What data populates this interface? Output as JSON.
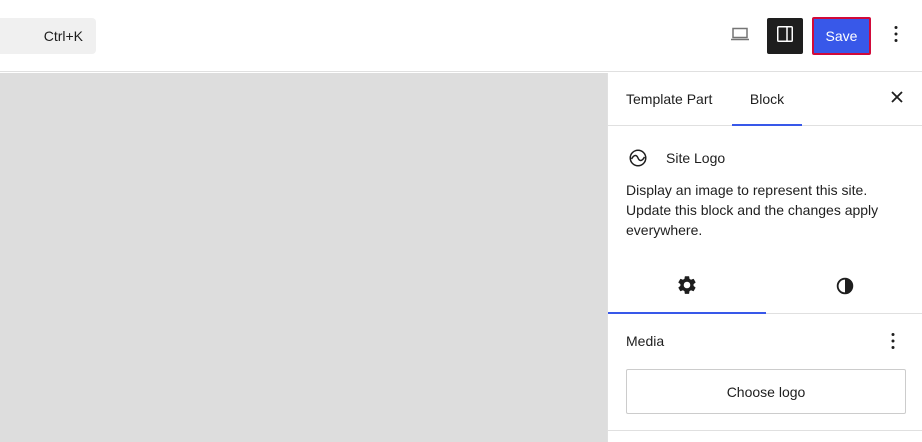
{
  "header": {
    "shortcut_hint": "Ctrl+K",
    "save_label": "Save",
    "device_icon": "laptop-icon",
    "settings_icon": "sidebar-toggle-icon",
    "more_icon": "vertical-ellipsis-icon"
  },
  "sidebar": {
    "tabs": [
      {
        "label": "Template Part",
        "active": false
      },
      {
        "label": "Block",
        "active": true
      }
    ],
    "close_icon": "close-icon",
    "block": {
      "icon": "site-logo-icon",
      "title": "Site Logo",
      "description": "Display an image to represent this site. Update this block and the changes apply everywhere."
    },
    "inspector_tabs": [
      {
        "icon": "gear-icon",
        "active": true
      },
      {
        "icon": "half-circle-styles-icon",
        "active": false
      }
    ],
    "media_panel": {
      "title": "Media",
      "button_label": "Choose logo"
    }
  },
  "colors": {
    "accent": "#3858e9",
    "save_outline": "#d10a3a",
    "canvas_bg": "#dddddd",
    "dark_button": "#1e1e1e"
  }
}
